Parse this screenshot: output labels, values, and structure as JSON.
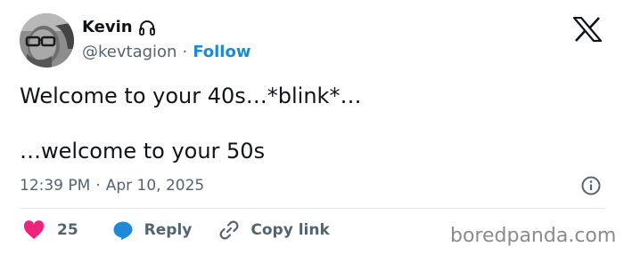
{
  "user": {
    "display_name": "Kevin",
    "badge_icon": "headphones-icon",
    "handle": "@kevtagion",
    "separator": "·",
    "follow_label": "Follow"
  },
  "tweet": {
    "line1": "Welcome to your 40s…*blink*…",
    "line2": "…welcome to your 50s",
    "time": "12:39 PM",
    "date_separator": "·",
    "date": "Apr 10, 2025"
  },
  "actions": {
    "like_count": "25",
    "reply_label": "Reply",
    "copy_link_label": "Copy link"
  },
  "watermark": "boredpanda.com",
  "colors": {
    "accent": "#1d8ad7",
    "like": "#f0237a",
    "reply": "#1d8ad7",
    "secondary_text": "#536471"
  }
}
